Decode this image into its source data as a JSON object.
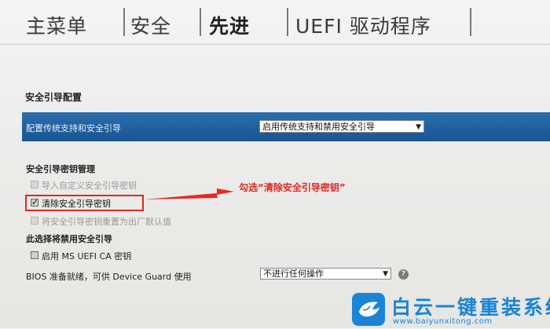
{
  "tabs": [
    {
      "label": "主菜单",
      "active": false
    },
    {
      "label": "安全",
      "active": false
    },
    {
      "label": "先进",
      "active": true
    },
    {
      "label": "UEFI 驱动程序",
      "active": false
    }
  ],
  "secure_boot": {
    "section_title": "安全引导配置",
    "config": {
      "label": "配置传统支持和安全引导",
      "value": "启用传统支持和禁用安全引导"
    },
    "key_mgmt": {
      "label": "安全引导密钥管理",
      "items": [
        {
          "label": "导入自定义安全引导密钥",
          "checked": false,
          "enabled": false
        },
        {
          "label": "清除安全引导密钥",
          "checked": true,
          "enabled": true
        },
        {
          "label": "将安全引导密钥重置为出厂默认值",
          "checked": false,
          "enabled": false
        }
      ]
    },
    "disable_note": "此选择将禁用安全引导",
    "ms_uefi_ca": {
      "label": "启用 MS UEFI CA 密钥",
      "checked": false
    }
  },
  "device_guard": {
    "label": "BIOS 准备就绪，可供 Device Guard 使用",
    "value": "不进行任何操作"
  },
  "annotation": "勾选“清除安全引导密钥”",
  "watermark": {
    "brand": "白云一键重装系统",
    "url": "www.baiyunxitong.com"
  },
  "colors": {
    "highlight_row": "#1f5f9f",
    "annotation": "#e0281e",
    "brand": "#1b84d6"
  },
  "icons": {
    "arrow": "red-arrow-icon",
    "help": "question-mark-icon",
    "logo": "bird-logo-icon",
    "dropdown": "chevron-down-icon",
    "check": "checkmark-icon"
  }
}
